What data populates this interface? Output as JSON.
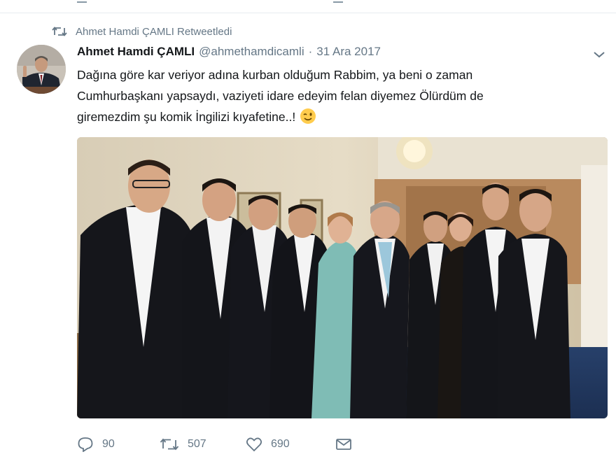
{
  "retweet_context": {
    "text": "Ahmet Hamdi ÇAMLI Retweetledi"
  },
  "tweet": {
    "author_name": "Ahmet Hamdi ÇAMLI",
    "author_handle": "@ahmethamdicamli",
    "separator": "·",
    "date": "31 Ara 2017",
    "text_lines": [
      "Dağına göre kar veriyor adına kurban olduğum Rabbim, ya beni o zaman",
      "Cumhurbaşkanı yapsaydı, vaziyeti idare edeyim felan diyemez Ölürdüm de",
      "giremezdim şu komik İngilizi kıyafetine..!"
    ],
    "emoji": "winking-face"
  },
  "actions": {
    "reply_count": "90",
    "retweet_count": "507",
    "like_count": "690"
  },
  "icons": {
    "retweet": "retweet-icon",
    "reply": "reply-icon",
    "like": "heart-icon",
    "message": "envelope-icon",
    "menu": "chevron-down-icon"
  },
  "colors": {
    "text_primary": "#14171a",
    "text_secondary": "#657786",
    "border": "#e6ecf0"
  }
}
